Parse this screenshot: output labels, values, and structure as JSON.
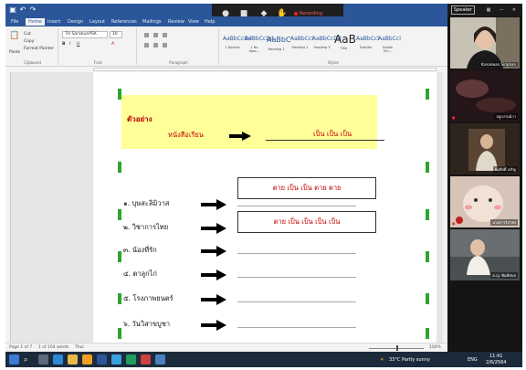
{
  "title_bar": {
    "quick_access": [
      "save-icon",
      "undo-icon",
      "redo-icon"
    ],
    "colors": {
      "word_blue": "#2b579a"
    }
  },
  "meeting_bar": {
    "recording_label": "Recording",
    "buttons": [
      "microphone-icon",
      "camera-icon",
      "share-screen-icon",
      "participants-icon"
    ]
  },
  "menu": {
    "tabs": [
      "File",
      "Home",
      "Insert",
      "Design",
      "Layout",
      "References",
      "Mailings",
      "Review",
      "View",
      "Help"
    ],
    "active_index": 1
  },
  "ribbon": {
    "clipboard": {
      "paste": "Paste",
      "cut": "Cut",
      "copy": "Copy",
      "format_painter": "Format Painter",
      "group": "Clipboard"
    },
    "font": {
      "name": "TH SarabunPSK",
      "size": "16",
      "group": "Font"
    },
    "paragraph": {
      "group": "Paragraph"
    },
    "styles": {
      "group": "Styles",
      "items": [
        {
          "sample": "AaBbCcDd",
          "name": "1 Normal"
        },
        {
          "sample": "AaBbCcDd",
          "name": "1 No Spac..."
        },
        {
          "sample": "AaBbC",
          "name": "Heading 1"
        },
        {
          "sample": "AaBbCcl",
          "name": "Heading 2"
        },
        {
          "sample": "AaBbCcDd",
          "name": "Heading 3"
        },
        {
          "sample": "AaB",
          "name": "Title"
        },
        {
          "sample": "AaBbCcl",
          "name": "Subtitle"
        },
        {
          "sample": "AaBbCcl",
          "name": "Subtle Em..."
        }
      ]
    }
  },
  "document": {
    "example": {
      "title": "ตัวอย่าง",
      "word": "หนังสือเรียน",
      "answer": "เป็น เป็น เป็น"
    },
    "questions": [
      {
        "word": "๑. บุษสะลิมิวาส"
      },
      {
        "word": "๒. วิชาการไทย"
      },
      {
        "word": "๓. น้องที่รัก"
      },
      {
        "word": "๔. ตาลูกไก่"
      },
      {
        "word": "๕. โรงภาพยนตร์"
      },
      {
        "word": "๖. วันวิสาขบูชา"
      }
    ],
    "answer_boxes": [
      {
        "text": "ตาย เป็น เป็น ตาย ตาย"
      },
      {
        "text": "ตาย เป็น เป็น เป็น เป็น"
      }
    ],
    "colors": {
      "highlight": "#ffff99",
      "answer_red": "#c00000",
      "marker_green": "#2fa42f"
    }
  },
  "status_bar": {
    "page": "Page 1 of 7",
    "words": "1 of 104 words",
    "language": "Thai",
    "zoom": "100%"
  },
  "taskbar": {
    "weather": "33°C Partly sunny",
    "time": "11:41",
    "date": "2/6/2564",
    "language": "ENG"
  },
  "video_panel": {
    "speaker_view": "Speaker",
    "participants": [
      {
        "name": "Kanokwan Siriphan"
      },
      {
        "name": "ปลูกงานนิวา"
      },
      {
        "name": "ธนกิตติ์ เจริญ"
      },
      {
        "name": "นางสาววิภาพร"
      },
      {
        "name": "ด.ญ. พิมพ์ชนก"
      }
    ]
  }
}
